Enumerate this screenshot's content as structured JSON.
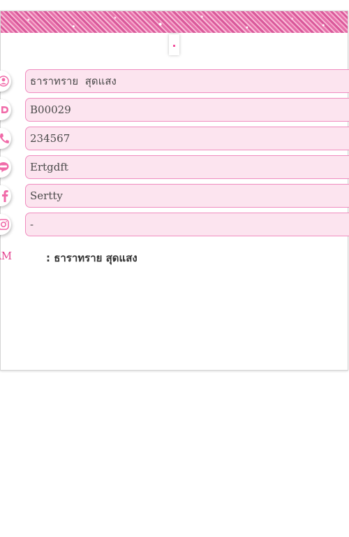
{
  "header": {
    "dot_color": "#f2529d",
    "accent": "#f08cbf"
  },
  "fields": [
    {
      "icon": "user-icon",
      "value": "ธาราทราย  สุดแสง"
    },
    {
      "icon": "id-icon",
      "value": "B00029"
    },
    {
      "icon": "phone-icon",
      "value": "234567"
    },
    {
      "icon": "line-icon",
      "value": "Ertgdft"
    },
    {
      "icon": "facebook-icon",
      "value": "Sertty"
    },
    {
      "icon": "instagram-icon",
      "value": "-"
    }
  ],
  "team": {
    "label": "EAM",
    "value": ": ธาราทราย สุดแสง"
  }
}
